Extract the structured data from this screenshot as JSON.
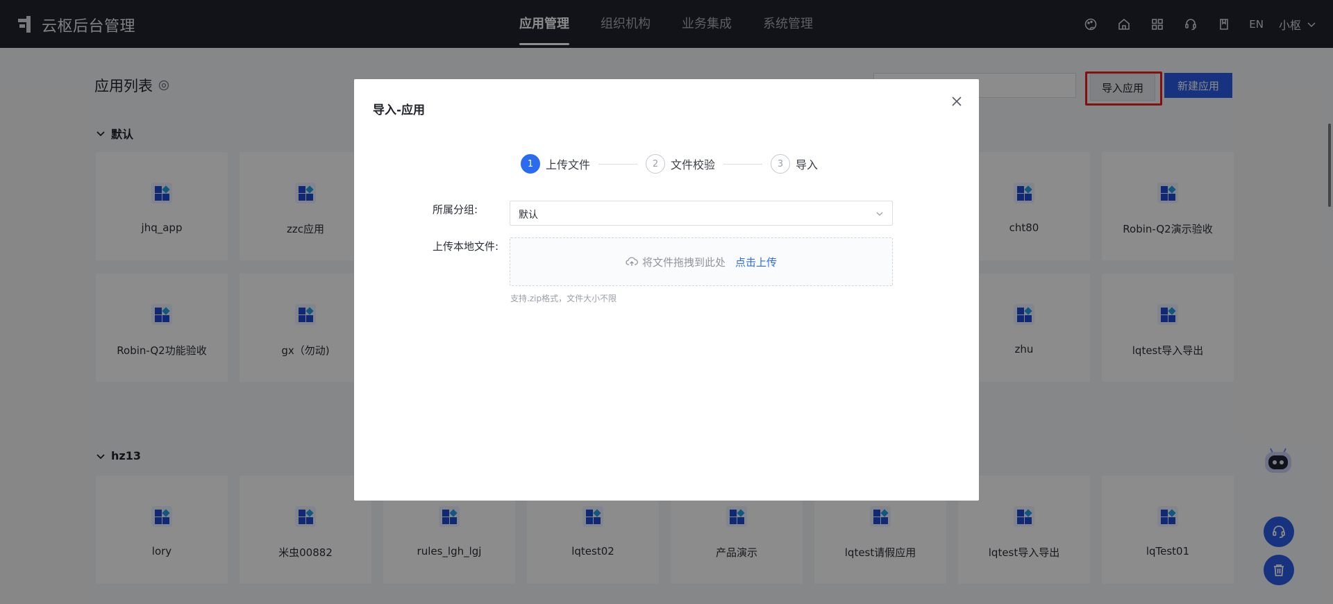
{
  "header": {
    "app_title": "云枢后台管理",
    "nav": [
      "应用管理",
      "组织机构",
      "业务集成",
      "系统管理"
    ],
    "active_nav": "应用管理",
    "lang": "EN",
    "user_name": "小枢"
  },
  "page": {
    "title": "应用列表",
    "import_button": "导入应用",
    "new_button": "新建应用"
  },
  "groups": [
    {
      "name": "默认",
      "apps": [
        "jhq_app",
        "zzc应用",
        "cht80",
        "Robin-Q2演示验收",
        "Robin-Q2功能验收",
        "gx（勿动)",
        "zhu",
        "lqtest导入导出"
      ]
    },
    {
      "name": "hz13",
      "apps": [
        "lory",
        "米虫00882",
        "rules_lgh_lgj",
        "lqtest02",
        "产品演示",
        "lqtest请假应用",
        "lqtest导入导出",
        "lqTest01"
      ]
    }
  ],
  "modal": {
    "title": "导入-应用",
    "steps": [
      {
        "num": "1",
        "label": "上传文件",
        "active": true
      },
      {
        "num": "2",
        "label": "文件校验",
        "active": false
      },
      {
        "num": "3",
        "label": "导入",
        "active": false
      }
    ],
    "group_label": "所属分组:",
    "group_value": "默认",
    "file_label": "上传本地文件:",
    "drag_text": "将文件拖拽到此处",
    "click_upload": "点击上传",
    "hint": "支持.zip格式，文件大小不限"
  },
  "colors": {
    "topbar": "#1f232e",
    "primary": "#2b5ce6",
    "highlight": "#ee1c1c"
  }
}
